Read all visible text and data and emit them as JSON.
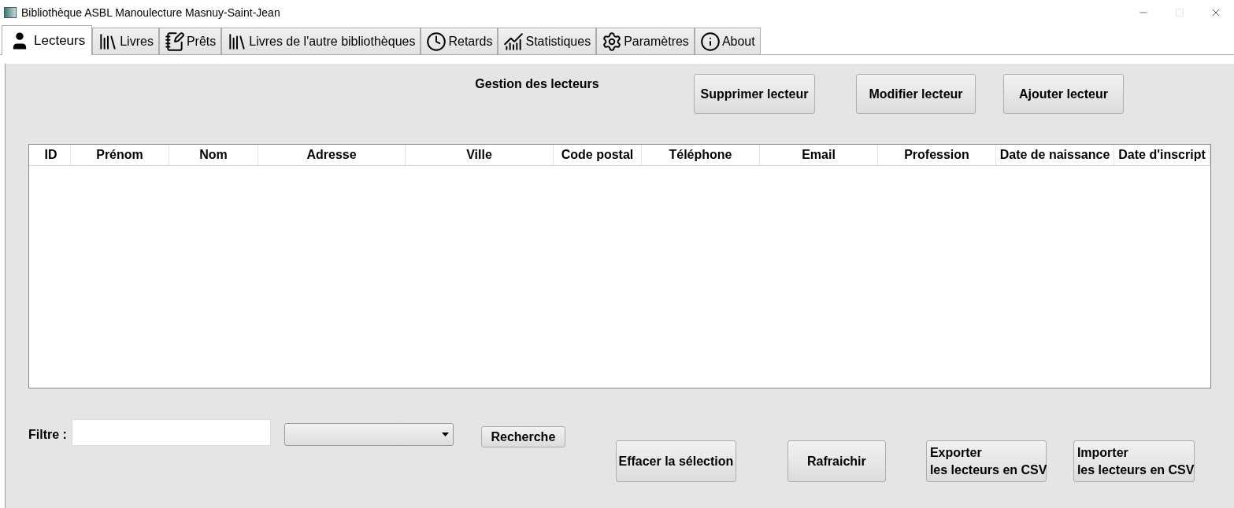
{
  "window": {
    "title": "Bibliothèque ASBL Manoulecture Masnuy-Saint-Jean"
  },
  "tabs": [
    {
      "label": "Lecteurs",
      "selected": true,
      "kind": "person"
    },
    {
      "label": "Livres",
      "selected": false,
      "kind": "books"
    },
    {
      "label": "Prêts",
      "selected": false,
      "kind": "notepad"
    },
    {
      "label": "Livres de l'autre bibliothèques",
      "selected": false,
      "kind": "books"
    },
    {
      "label": "Retards",
      "selected": false,
      "kind": "clock"
    },
    {
      "label": "Statistiques",
      "selected": false,
      "kind": "chart"
    },
    {
      "label": "Paramètres",
      "selected": false,
      "kind": "gear"
    },
    {
      "label": "About",
      "selected": false,
      "kind": "info"
    }
  ],
  "heading": "Gestion des lecteurs",
  "top_buttons": [
    "Supprimer lecteur",
    "Modifier lecteur",
    "Ajouter lecteur"
  ],
  "table": {
    "columns": [
      "ID",
      "Prénom",
      "Nom",
      "Adresse",
      "Ville",
      "Code postal",
      "Téléphone",
      "Email",
      "Profession",
      "Date de naissance",
      "Date d'inscript"
    ]
  },
  "filter": {
    "label": "Filtre :",
    "search_button": "Recherche"
  },
  "bottom_buttons": [
    [
      "Effacer la sélection"
    ],
    [
      "Rafraichir"
    ],
    [
      "Exporter",
      "les lecteurs en CSV"
    ],
    [
      "Importer",
      "les lecteurs en CSV"
    ]
  ]
}
